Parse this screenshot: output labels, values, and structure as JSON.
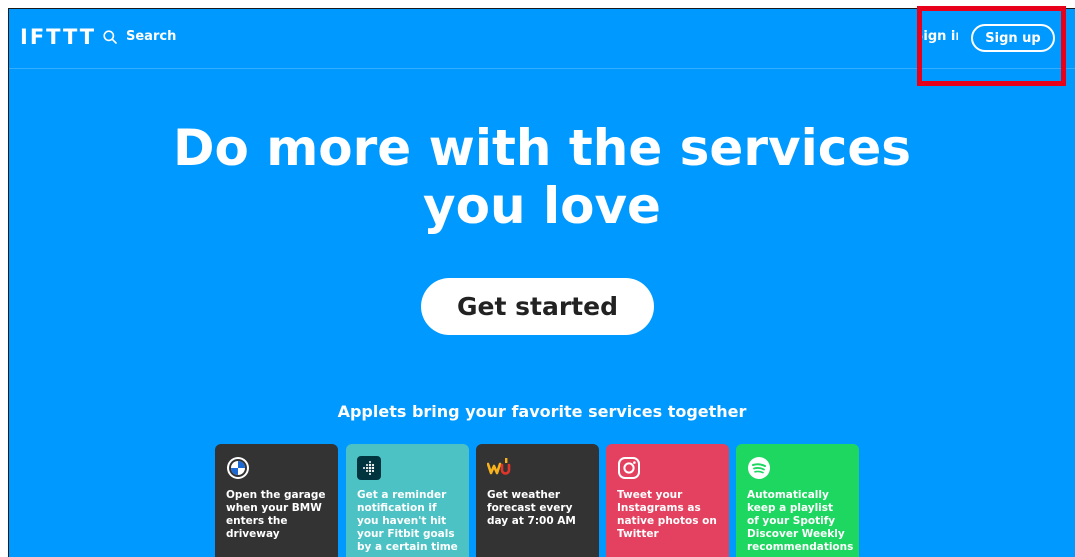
{
  "header": {
    "logo": "IFTTT",
    "search_label": "Search",
    "signin_label": "Sign in",
    "signup_label": "Sign up"
  },
  "hero": {
    "title_line1": "Do more with the services",
    "title_line2": "you love",
    "cta_label": "Get started"
  },
  "applets": {
    "tagline": "Applets bring your favorite services together",
    "cards": [
      {
        "service_icon": "bmw-logo-icon",
        "color": "#333333",
        "title": "Open the garage when your BMW enters the driveway"
      },
      {
        "service_icon": "fitbit-logo-icon",
        "color": "#4cc2c4",
        "title": "Get a reminder notification if you haven't hit your Fitbit goals by a certain time"
      },
      {
        "service_icon": "weather-underground-logo-icon",
        "color": "#333333",
        "title": "Get weather forecast every day at 7:00 AM"
      },
      {
        "service_icon": "instagram-logo-icon",
        "color": "#e4405f",
        "title": "Tweet your Instagrams as native photos on Twitter"
      },
      {
        "service_icon": "spotify-logo-icon",
        "color": "#1ed760",
        "title": "Automatically keep a playlist of your Spotify Discover Weekly recommendations"
      }
    ]
  },
  "colors": {
    "page_background": "#0099ff",
    "highlight_box": "#e8001a"
  }
}
